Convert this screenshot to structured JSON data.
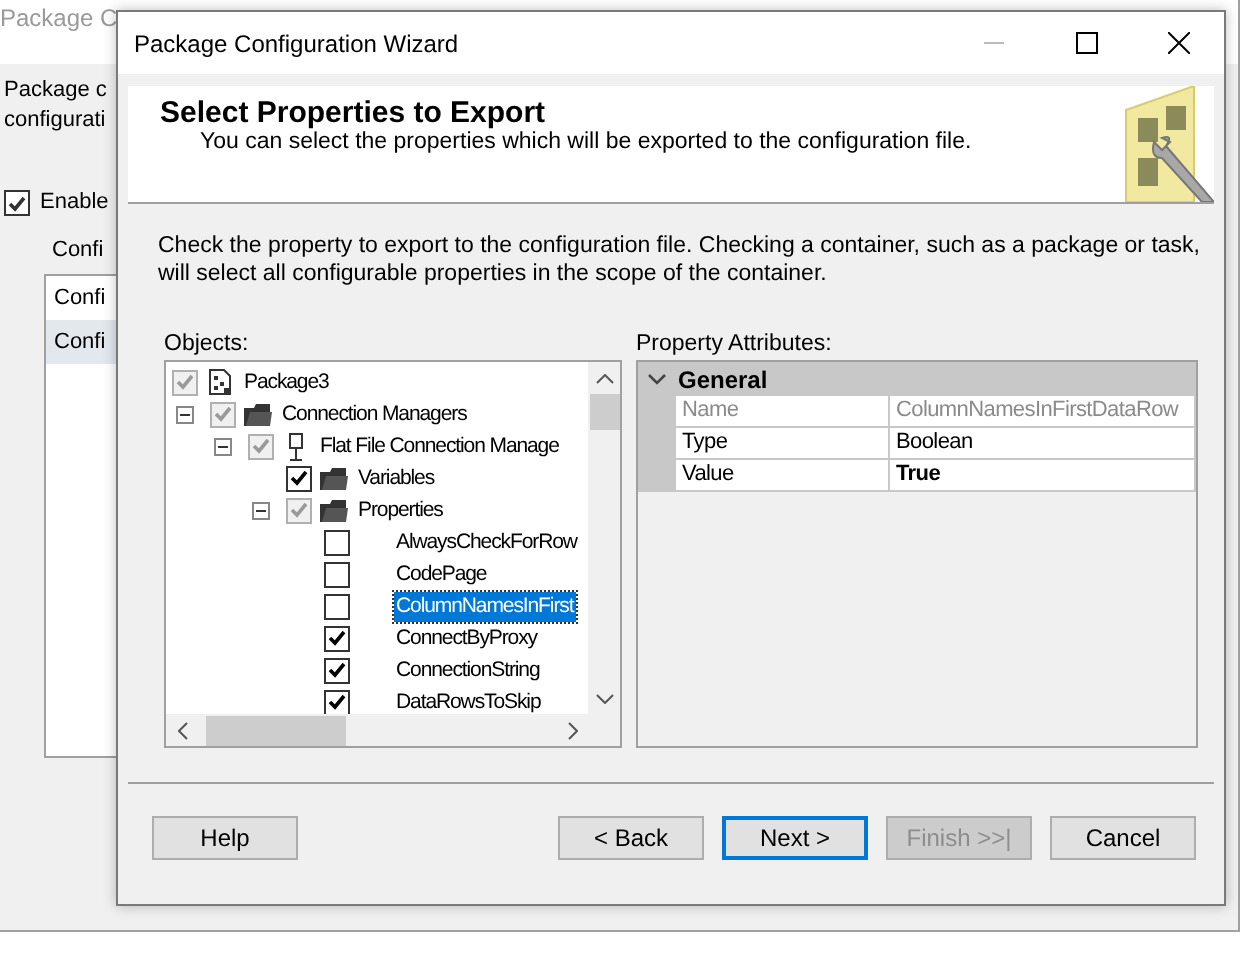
{
  "background_window": {
    "title": "Package C",
    "intro_lines": [
      "Package c",
      "configurati"
    ],
    "enable_checkbox": {
      "label": "Enable",
      "checked": true
    },
    "list_label": "Confi",
    "list_items": [
      {
        "label": "Confi",
        "selected": false
      },
      {
        "label": "Confi",
        "selected": true
      }
    ]
  },
  "wizard": {
    "title": "Package Configuration Wizard",
    "header": {
      "title": "Select Properties to Export",
      "subtitle": "You can select the properties which will be exported to the configuration file."
    },
    "instructions": "Check the property to export to the configuration file. Checking a container, such as a package or task, will select all configurable properties in the scope of the container.",
    "objects_label": "Objects:",
    "tree": [
      {
        "label": "Package3",
        "kind": "package",
        "checked": true,
        "disabled": true,
        "selected": false,
        "children": [
          {
            "label": "Connection Managers",
            "kind": "folder",
            "checked": true,
            "disabled": true,
            "expanded": true,
            "selected": false,
            "children": [
              {
                "label": "Flat File Connection Manage",
                "kind": "connection",
                "checked": true,
                "disabled": true,
                "expanded": true,
                "selected": false,
                "children": [
                  {
                    "label": "Variables",
                    "kind": "folder",
                    "checked": true,
                    "disabled": false,
                    "selected": false
                  },
                  {
                    "label": "Properties",
                    "kind": "folder",
                    "checked": true,
                    "disabled": true,
                    "expanded": true,
                    "selected": false,
                    "children": [
                      {
                        "label": "AlwaysCheckForRow",
                        "checked": false,
                        "disabled": false,
                        "selected": false
                      },
                      {
                        "label": "CodePage",
                        "checked": false,
                        "disabled": false,
                        "selected": false
                      },
                      {
                        "label": "ColumnNamesInFirst",
                        "checked": false,
                        "disabled": false,
                        "selected": true
                      },
                      {
                        "label": "ConnectByProxy",
                        "checked": true,
                        "disabled": false,
                        "selected": false
                      },
                      {
                        "label": "ConnectionString",
                        "checked": true,
                        "disabled": false,
                        "selected": false
                      },
                      {
                        "label": "DataRowsToSkip",
                        "checked": true,
                        "disabled": false,
                        "selected": false
                      }
                    ]
                  }
                ]
              }
            ]
          }
        ]
      }
    ],
    "attributes_label": "Property Attributes:",
    "property_grid": {
      "category": "General",
      "expanded": true,
      "rows": [
        {
          "name": "Name",
          "value": "ColumnNamesInFirstDataRow",
          "read_only": true,
          "modified": false
        },
        {
          "name": "Type",
          "value": "Boolean",
          "read_only": false,
          "modified": false
        },
        {
          "name": "Value",
          "value": "True",
          "read_only": false,
          "modified": true
        }
      ]
    },
    "buttons": [
      {
        "label": "Help",
        "kind": "left",
        "disabled": false,
        "focused": false
      },
      {
        "label": "< Back",
        "kind": "right",
        "disabled": false,
        "focused": false
      },
      {
        "label": "Next >",
        "kind": "right",
        "disabled": false,
        "focused": true
      },
      {
        "label": "Finish >>|",
        "kind": "right",
        "disabled": true,
        "focused": false
      },
      {
        "label": "Cancel",
        "kind": "right",
        "disabled": false,
        "focused": false
      }
    ]
  }
}
